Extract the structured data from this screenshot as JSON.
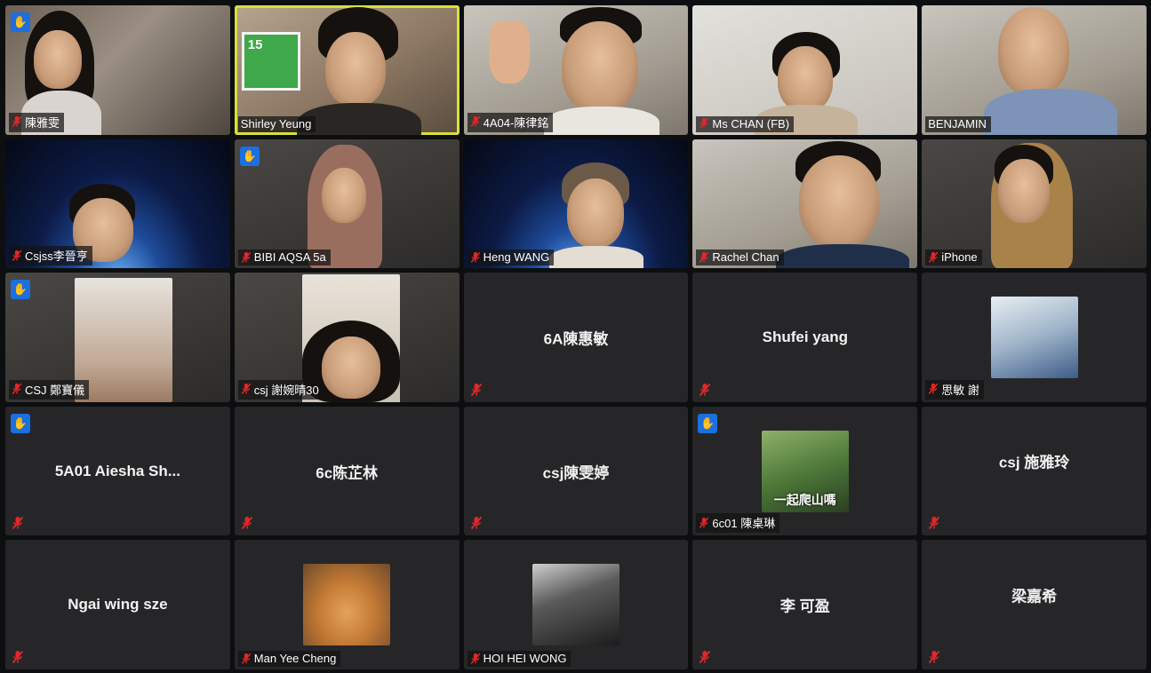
{
  "participants": [
    {
      "name": "陳雅雯",
      "view": "video",
      "bg": "room",
      "hand": true,
      "muted": true,
      "person": "girl"
    },
    {
      "name": "Shirley Yeung",
      "view": "video",
      "bg": "warm",
      "hand": false,
      "muted": false,
      "active": true,
      "person": "sdg"
    },
    {
      "name": "4A04-陳律銘",
      "view": "video",
      "bg": "light",
      "hand": false,
      "muted": true,
      "person": "thumbs"
    },
    {
      "name": "Ms CHAN (FB)",
      "view": "video",
      "bg": "white",
      "hand": false,
      "muted": true,
      "person": "woman"
    },
    {
      "name": "BENJAMIN",
      "view": "video",
      "bg": "light",
      "hand": false,
      "muted": false,
      "person": "man-dark"
    },
    {
      "name": "Csjss李晉亨",
      "view": "video",
      "bg": "space",
      "hand": false,
      "muted": true,
      "person": "boy"
    },
    {
      "name": "BIBI AQSA 5a",
      "view": "video",
      "bg": "dim",
      "hand": true,
      "muted": true,
      "person": "hijab"
    },
    {
      "name": "Heng WANG",
      "view": "video",
      "bg": "space",
      "hand": false,
      "muted": true,
      "person": "glasses"
    },
    {
      "name": "Rachel Chan",
      "view": "video",
      "bg": "light",
      "hand": false,
      "muted": true,
      "person": "man"
    },
    {
      "name": "iPhone",
      "view": "video",
      "bg": "dim",
      "hand": false,
      "muted": true,
      "person": "scarf"
    },
    {
      "name": "CSJ 鄭寶儀",
      "view": "video",
      "bg": "dim",
      "hand": true,
      "muted": true,
      "person": "ceiling"
    },
    {
      "name": "csj 謝婉晴30",
      "view": "video",
      "bg": "dim",
      "hand": false,
      "muted": true,
      "person": "girl-low"
    },
    {
      "name": "6A陳惠敏",
      "view": "name",
      "hand": false,
      "muted": true
    },
    {
      "name": "Shufei yang",
      "view": "name",
      "hand": false,
      "muted": true
    },
    {
      "name": "思敏 謝",
      "view": "thumb",
      "thumb": "anime",
      "hand": false,
      "muted": true
    },
    {
      "name": "5A01 Aiesha Sh...",
      "view": "name",
      "hand": true,
      "muted": true
    },
    {
      "name": "6c陈芷林",
      "view": "name",
      "hand": false,
      "muted": true
    },
    {
      "name": "csj陳雯婷",
      "view": "name",
      "hand": false,
      "muted": true
    },
    {
      "name": "6c01 陳桌琳",
      "view": "thumb",
      "thumb": "green",
      "caption": "一起爬山嗎",
      "hand": true,
      "muted": true
    },
    {
      "name": "csj 施雅玲",
      "view": "name",
      "up": true,
      "hand": false,
      "muted": true
    },
    {
      "name": "Ngai wing sze",
      "view": "name",
      "hand": false,
      "muted": true
    },
    {
      "name": "Man Yee Cheng",
      "view": "thumb",
      "thumb": "cat",
      "hand": false,
      "muted": true
    },
    {
      "name": "HOI HEI WONG",
      "view": "thumb",
      "thumb": "dark",
      "hand": false,
      "muted": true
    },
    {
      "name": "李 可盈",
      "view": "name",
      "hand": false,
      "muted": true
    },
    {
      "name": "梁嘉希",
      "view": "name",
      "up": true,
      "hand": false,
      "muted": true
    }
  ],
  "icons": {
    "mic_off": "microphone-muted-icon",
    "hand": "raised-hand-icon",
    "hand_glyph": "✋"
  },
  "colors": {
    "tile_bg": "#262629",
    "active_speaker": "#d9e03a",
    "hand_blue": "#1b6fe0",
    "mic_red": "#e02828"
  }
}
